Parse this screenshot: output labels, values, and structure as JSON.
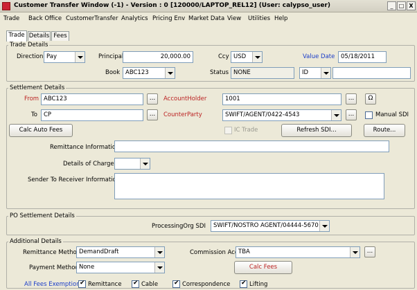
{
  "window": {
    "title": "Customer Transfer Window  (-1) - Version : 0  [120000/LAPTOP_REL12] (User: calypso_user)",
    "min": "_",
    "max": "□",
    "close": "X"
  },
  "menu": [
    "Trade",
    "Back Office",
    "CustomerTransfer",
    "Analytics",
    "Pricing Env",
    "Market Data",
    "View",
    "Utilities",
    "Help"
  ],
  "tabs": [
    "Trade",
    "Details",
    "Fees"
  ],
  "trade_details": {
    "title": "Trade Details",
    "direction_label": "Direction",
    "direction_value": "Pay",
    "principal_label": "Principal",
    "principal_value": "20,000.00",
    "ccy_label": "Ccy",
    "ccy_value": "USD",
    "value_date_label": "Value Date",
    "value_date_value": "05/18/2011",
    "book_label": "Book",
    "book_value": "ABC123",
    "status_label": "Status",
    "status_value": "NONE",
    "id_value": "ID",
    "id_input": ""
  },
  "settlement": {
    "title": "Settlement Details",
    "from_label": "From",
    "from_value": "ABC123",
    "account_holder_label": "AccountHolder",
    "account_holder_value": "1001",
    "to_label": "To",
    "to_value": "CP",
    "counterparty_label": "CounterParty",
    "counterparty_value": "SWIFT/AGENT/0422-4543",
    "manual_sdi_label": "Manual SDI",
    "calc_auto_fees": "Calc Auto Fees",
    "ic_trade_label": "IC Trade",
    "refresh_sdi": "Refresh SDI...",
    "route": "Route...",
    "remittance_info_label": "Remittance Information",
    "remittance_info_value": "",
    "details_of_charges_label": "Details of Charges",
    "details_of_charges_value": "",
    "sender_to_receiver_label": "Sender To Receiver Information",
    "ellipsis": "...",
    "refresh_glyph": "Ω"
  },
  "po_settlement": {
    "title": "PO Settlement Details",
    "processing_org_sdi_label": "ProcessingOrg SDI",
    "processing_org_sdi_value": "SWIFT/NOSTRO AGENT/04444-5670"
  },
  "additional": {
    "title": "Additional Details",
    "remittance_method_label": "Remittance Method",
    "remittance_method_value": "DemandDraft",
    "commission_acc_label": "Commission Acc.",
    "commission_acc_value": "TBA",
    "payment_method_label": "Payment Method",
    "payment_method_value": "None",
    "calc_fees": "Calc Fees",
    "all_fees_exemption_label": "All Fees Exemption",
    "remittance_chk": "Remittance",
    "cable_chk": "Cable",
    "correspondence_chk": "Correspondence",
    "lifting_chk": "Lifting"
  },
  "colors": {
    "red_label": "#b22222",
    "blue_label": "#1a3cc8",
    "window_bg": "#ece9d8"
  }
}
